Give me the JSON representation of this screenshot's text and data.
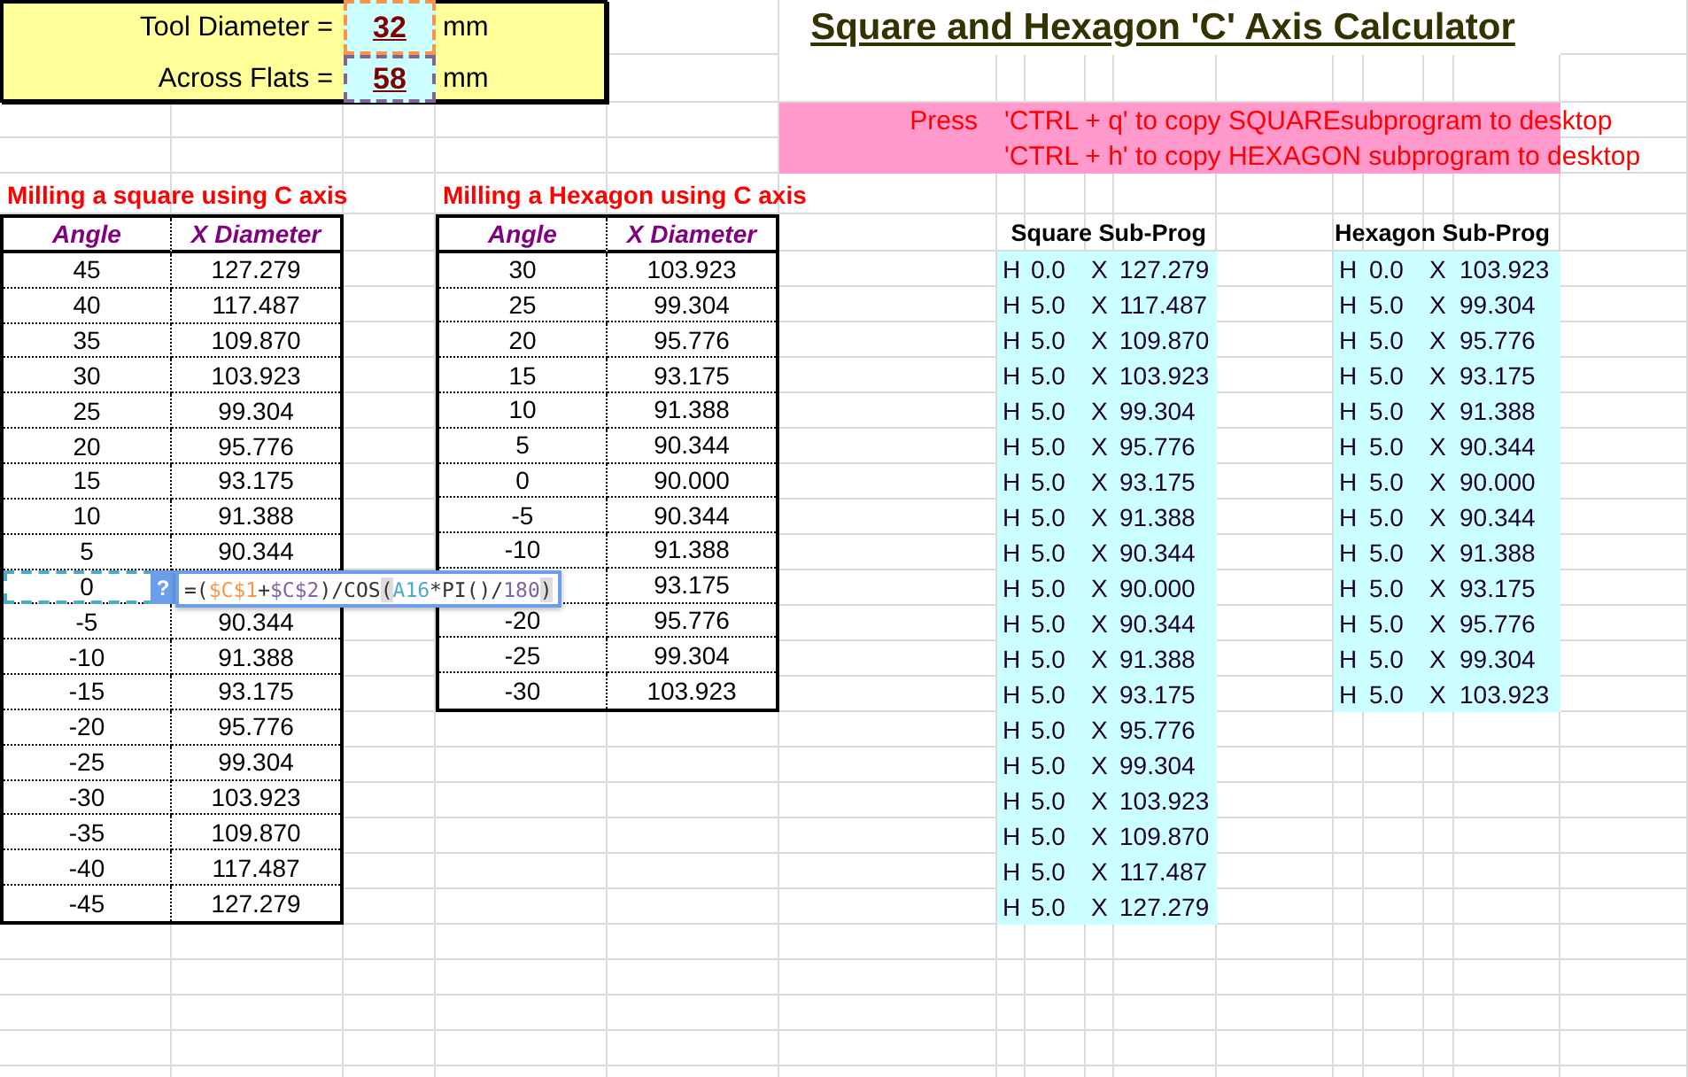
{
  "header": {
    "inputs": [
      {
        "label": "Tool Diameter =",
        "value": "32",
        "unit": "mm",
        "color": "#f79646"
      },
      {
        "label": "Across Flats =",
        "value": "58",
        "unit": "mm",
        "color": "#8064a2"
      }
    ],
    "title": "Square and Hexagon 'C' Axis Calculator"
  },
  "notice": {
    "prefix": "Press",
    "lines": [
      "'CTRL + q' to copy SQUAREsubprogram to desktop",
      "'CTRL + h' to copy HEXAGON subprogram to desktop"
    ]
  },
  "square_table": {
    "title": "Milling a square using C axis",
    "columns": [
      "Angle",
      "X Diameter"
    ],
    "rows": [
      {
        "angle": "45",
        "x_diameter": "127.279",
        "referenced": false
      },
      {
        "angle": "40",
        "x_diameter": "117.487",
        "referenced": false
      },
      {
        "angle": "35",
        "x_diameter": "109.870",
        "referenced": false
      },
      {
        "angle": "30",
        "x_diameter": "103.923",
        "referenced": false
      },
      {
        "angle": "25",
        "x_diameter": "99.304",
        "referenced": false
      },
      {
        "angle": "20",
        "x_diameter": "95.776",
        "referenced": false
      },
      {
        "angle": "15",
        "x_diameter": "93.175",
        "referenced": false
      },
      {
        "angle": "10",
        "x_diameter": "91.388",
        "referenced": false
      },
      {
        "angle": "5",
        "x_diameter": "90.344",
        "referenced": false
      },
      {
        "angle": "0",
        "referenced": true
      },
      {
        "angle": "-5",
        "x_diameter": "90.344",
        "referenced": false
      },
      {
        "angle": "-10",
        "x_diameter": "91.388",
        "referenced": false
      },
      {
        "angle": "-15",
        "x_diameter": "93.175",
        "referenced": false
      },
      {
        "angle": "-20",
        "x_diameter": "95.776",
        "referenced": false
      },
      {
        "angle": "-25",
        "x_diameter": "99.304",
        "referenced": false
      },
      {
        "angle": "-30",
        "x_diameter": "103.923",
        "referenced": false
      },
      {
        "angle": "-35",
        "x_diameter": "109.870",
        "referenced": false
      },
      {
        "angle": "-40",
        "x_diameter": "117.487",
        "referenced": false
      },
      {
        "angle": "-45",
        "x_diameter": "127.279",
        "referenced": false
      }
    ]
  },
  "hexagon_table": {
    "title": "Milling a Hexagon using C axis",
    "columns": [
      "Angle",
      "X Diameter"
    ],
    "rows": [
      {
        "angle": "30",
        "x_diameter": "103.923"
      },
      {
        "angle": "25",
        "x_diameter": "99.304"
      },
      {
        "angle": "20",
        "x_diameter": "95.776"
      },
      {
        "angle": "15",
        "x_diameter": "93.175"
      },
      {
        "angle": "10",
        "x_diameter": "91.388"
      },
      {
        "angle": "5",
        "x_diameter": "90.344"
      },
      {
        "angle": "0",
        "x_diameter": "90.000"
      },
      {
        "angle": "-5",
        "x_diameter": "90.344"
      },
      {
        "angle": "-10",
        "x_diameter": "91.388"
      },
      {
        "x_diameter": "93.175"
      },
      {
        "angle": "-20",
        "x_diameter": "95.776"
      },
      {
        "angle": "-25",
        "x_diameter": "99.304"
      },
      {
        "angle": "-30",
        "x_diameter": "103.923"
      }
    ]
  },
  "square_subprogram": {
    "title": "Square Sub-Prog",
    "rows": [
      [
        "H",
        "0.0",
        "X",
        "127.279"
      ],
      [
        "H",
        "5.0",
        "X",
        "117.487"
      ],
      [
        "H",
        "5.0",
        "X",
        "109.870"
      ],
      [
        "H",
        "5.0",
        "X",
        "103.923"
      ],
      [
        "H",
        "5.0",
        "X",
        "99.304"
      ],
      [
        "H",
        "5.0",
        "X",
        "95.776"
      ],
      [
        "H",
        "5.0",
        "X",
        "93.175"
      ],
      [
        "H",
        "5.0",
        "X",
        "91.388"
      ],
      [
        "H",
        "5.0",
        "X",
        "90.344"
      ],
      [
        "H",
        "5.0",
        "X",
        "90.000"
      ],
      [
        "H",
        "5.0",
        "X",
        "90.344"
      ],
      [
        "H",
        "5.0",
        "X",
        "91.388"
      ],
      [
        "H",
        "5.0",
        "X",
        "93.175"
      ],
      [
        "H",
        "5.0",
        "X",
        "95.776"
      ],
      [
        "H",
        "5.0",
        "X",
        "99.304"
      ],
      [
        "H",
        "5.0",
        "X",
        "103.923"
      ],
      [
        "H",
        "5.0",
        "X",
        "109.870"
      ],
      [
        "H",
        "5.0",
        "X",
        "117.487"
      ],
      [
        "H",
        "5.0",
        "X",
        "127.279"
      ]
    ]
  },
  "hexagon_subprogram": {
    "title": "Hexagon Sub-Prog",
    "rows": [
      [
        "H",
        "0.0",
        "X",
        "103.923"
      ],
      [
        "H",
        "5.0",
        "X",
        "99.304"
      ],
      [
        "H",
        "5.0",
        "X",
        "95.776"
      ],
      [
        "H",
        "5.0",
        "X",
        "93.175"
      ],
      [
        "H",
        "5.0",
        "X",
        "91.388"
      ],
      [
        "H",
        "5.0",
        "X",
        "90.344"
      ],
      [
        "H",
        "5.0",
        "X",
        "90.000"
      ],
      [
        "H",
        "5.0",
        "X",
        "90.344"
      ],
      [
        "H",
        "5.0",
        "X",
        "91.388"
      ],
      [
        "H",
        "5.0",
        "X",
        "93.175"
      ],
      [
        "H",
        "5.0",
        "X",
        "95.776"
      ],
      [
        "H",
        "5.0",
        "X",
        "99.304"
      ],
      [
        "H",
        "5.0",
        "X",
        "103.923"
      ]
    ]
  },
  "formula_popup": {
    "hint": "?",
    "tokens": [
      {
        "text": "=(",
        "color": "#333333",
        "highlighted": false
      },
      {
        "text": "$C$1",
        "color": "#f79646",
        "highlighted": false
      },
      {
        "text": "+",
        "color": "#333333",
        "highlighted": false
      },
      {
        "text": "$C$2",
        "color": "#8064a2",
        "highlighted": false
      },
      {
        "text": ")/COS",
        "color": "#333333",
        "highlighted": false
      },
      {
        "text": "(",
        "color": "#333333",
        "highlighted": true
      },
      {
        "text": "A16",
        "color": "#4bacc6",
        "highlighted": false
      },
      {
        "text": "*PI()/",
        "color": "#333333",
        "highlighted": false
      },
      {
        "text": "180",
        "color": "#8064a2",
        "highlighted": false
      },
      {
        "text": ")",
        "color": "#333333",
        "highlighted": true
      }
    ]
  }
}
